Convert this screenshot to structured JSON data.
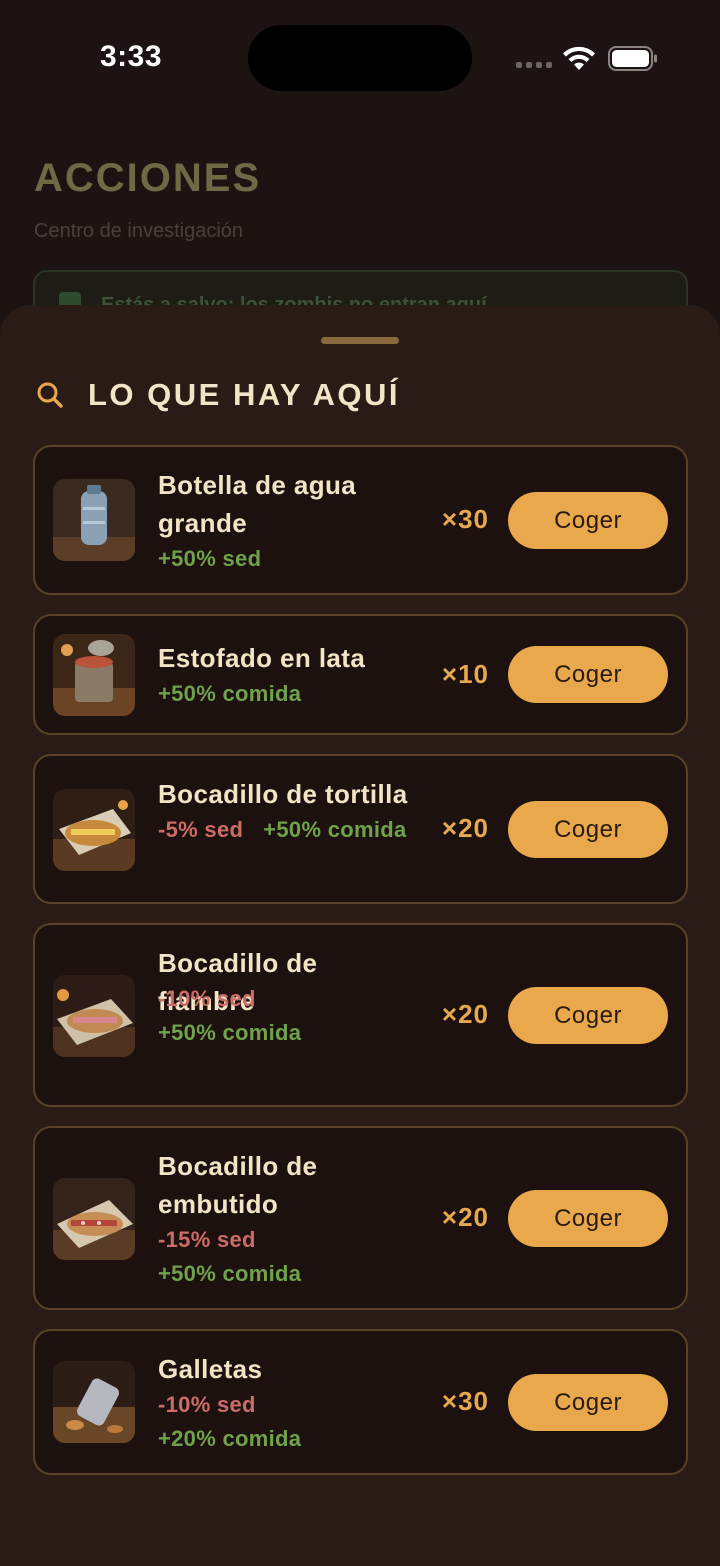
{
  "status_bar": {
    "time": "3:33"
  },
  "background": {
    "title": "ACCIONES",
    "subtitle": "Centro de investigación",
    "banner_text": "Estás a salvo: los zombis no entran aquí"
  },
  "sheet": {
    "title": "LO QUE HAY AQUÍ",
    "items": [
      {
        "name": "Botella de agua grande",
        "effects": [
          {
            "text": "+50% sed",
            "kind": "positive"
          }
        ],
        "quantity": "×30",
        "action": "Coger",
        "image": "water-bottle"
      },
      {
        "name": "Estofado en lata",
        "effects": [
          {
            "text": "+50% comida",
            "kind": "positive"
          }
        ],
        "quantity": "×10",
        "action": "Coger",
        "image": "canned-stew"
      },
      {
        "name": "Bocadillo de tortilla",
        "effects": [
          {
            "text": "-5% sed",
            "kind": "negative"
          },
          {
            "text": "+50% comida",
            "kind": "positive"
          }
        ],
        "quantity": "×20",
        "action": "Coger",
        "image": "omelette-sandwich"
      },
      {
        "name": "Bocadillo de fiambre",
        "effects": [
          {
            "text": "-10% sed",
            "kind": "negative"
          },
          {
            "text": "+50% comida",
            "kind": "positive"
          }
        ],
        "quantity": "×20",
        "action": "Coger",
        "image": "ham-sandwich"
      },
      {
        "name": "Bocadillo de embutido",
        "effects": [
          {
            "text": "-15% sed",
            "kind": "negative"
          },
          {
            "text": "+50% comida",
            "kind": "positive"
          }
        ],
        "quantity": "×20",
        "action": "Coger",
        "image": "sausage-sandwich"
      },
      {
        "name": "Galletas",
        "effects": [
          {
            "text": "-10% sed",
            "kind": "negative"
          },
          {
            "text": "+20% comida",
            "kind": "positive"
          }
        ],
        "quantity": "×30",
        "action": "Coger",
        "image": "cookies"
      }
    ]
  },
  "colors": {
    "accent": "#e9a84b",
    "positive": "#6fa24b",
    "negative": "#cc6c66",
    "sheet_bg": "#2a1b16",
    "card_bg": "#1c110f",
    "card_border": "#5b4226"
  }
}
